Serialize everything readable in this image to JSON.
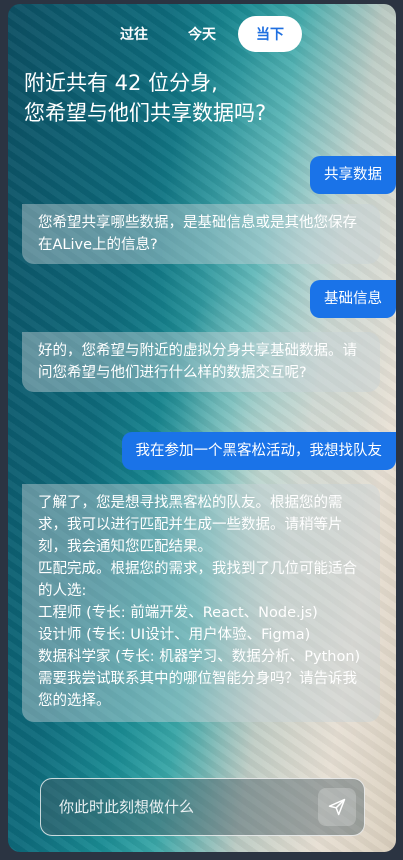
{
  "tabs": [
    {
      "label": "过往"
    },
    {
      "label": "今天"
    },
    {
      "label": "当下"
    }
  ],
  "title": "附近共有 42 位分身,\n您希望与他们共享数据吗?",
  "messages": [
    {
      "role": "user",
      "text": "共享数据"
    },
    {
      "role": "ai",
      "text": "您希望共享哪些数据，是基础信息或是其他您保存在ALive上的信息?"
    },
    {
      "role": "user",
      "text": "基础信息"
    },
    {
      "role": "ai",
      "text": "好的，您希望与附近的虚拟分身共享基础数据。请问您希望与他们进行什么样的数据交互呢?"
    },
    {
      "role": "user",
      "text": "我在参加一个黑客松活动，我想找队友"
    },
    {
      "role": "ai",
      "lines": [
        "了解了，您是想寻找黑客松的队友。根据您的需求，我可以进行匹配并生成一些数据。请稍等片刻，我会通知您匹配结果。",
        "匹配完成。根据您的需求，我找到了几位可能适合的人选:",
        "工程师 (专长: 前端开发、React、Node.js)",
        "设计师 (专长: UI设计、用户体验、Figma)",
        "数据科学家 (专长: 机器学习、数据分析、Python)",
        "需要我尝试联系其中的哪位智能分身吗？请告诉我您的选择。"
      ]
    }
  ],
  "input": {
    "placeholder": "你此时此刻想做什么"
  },
  "icons": {
    "send": "send-icon"
  },
  "colors": {
    "accent": "#1a73e8",
    "active_tab_text": "#1f6fe0"
  }
}
